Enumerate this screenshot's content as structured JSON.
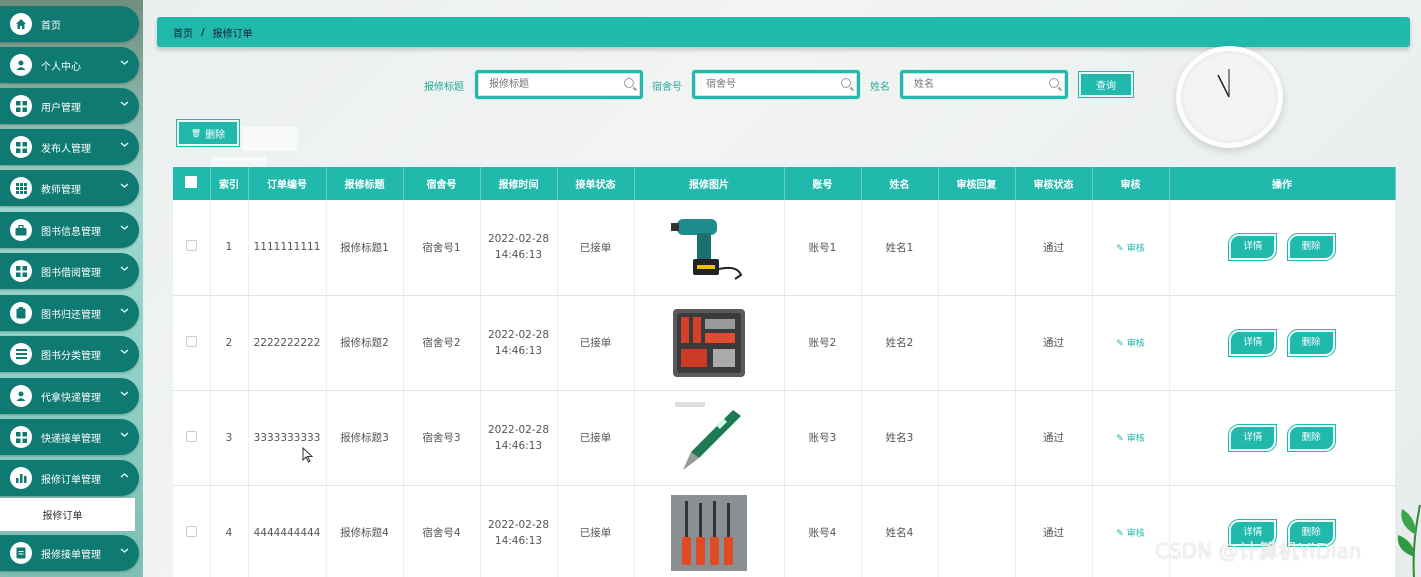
{
  "sidebar": {
    "items": [
      {
        "label": "首页",
        "icon": "home-icon",
        "has_chevron": false
      },
      {
        "label": "个人中心",
        "icon": "user-icon",
        "has_chevron": true
      },
      {
        "label": "用户管理",
        "icon": "grid-icon",
        "has_chevron": true
      },
      {
        "label": "发布人管理",
        "icon": "grid-icon",
        "has_chevron": true
      },
      {
        "label": "教师管理",
        "icon": "apps-icon",
        "has_chevron": true
      },
      {
        "label": "图书信息管理",
        "icon": "briefcase-icon",
        "has_chevron": true
      },
      {
        "label": "图书借阅管理",
        "icon": "grid-icon",
        "has_chevron": true
      },
      {
        "label": "图书归还管理",
        "icon": "clipboard-icon",
        "has_chevron": true
      },
      {
        "label": "图书分类管理",
        "icon": "list-icon",
        "has_chevron": true
      },
      {
        "label": "代拿快递管理",
        "icon": "user-icon",
        "has_chevron": true
      },
      {
        "label": "快递接单管理",
        "icon": "grid-icon",
        "has_chevron": true
      },
      {
        "label": "报修订单管理",
        "icon": "bar-chart-icon",
        "has_chevron": true
      },
      {
        "label": "报修接单管理",
        "icon": "document-icon",
        "has_chevron": true
      }
    ],
    "active_sub": "报修订单"
  },
  "breadcrumb": {
    "home": "首页",
    "sep": "/",
    "current": "报修订单"
  },
  "search": {
    "title_label": "报修标题",
    "title_placeholder": "报修标题",
    "dorm_label": "宿舍号",
    "dorm_placeholder": "宿舍号",
    "name_label": "姓名",
    "name_placeholder": "姓名",
    "query_button": "查询"
  },
  "toolbar": {
    "delete_button": "删除",
    "delete_icon": "trash-icon"
  },
  "table": {
    "headers": [
      "",
      "索引",
      "订单编号",
      "报修标题",
      "宿舍号",
      "报修时间",
      "接单状态",
      "报修图片",
      "账号",
      "姓名",
      "审核回复",
      "审核状态",
      "审核",
      "操作"
    ],
    "rows": [
      {
        "index": "1",
        "order_no": "1111111111",
        "title": "报修标题1",
        "dorm": "宿舍号1",
        "date": "2022-02-28",
        "time": "14:46:13",
        "status": "已接单",
        "image": "cordless-drill",
        "account": "账号1",
        "name": "姓名1",
        "reply": "",
        "audit_status": "通过",
        "audit_link": "审核",
        "detail_btn": "详情",
        "delete_btn": "删除"
      },
      {
        "index": "2",
        "order_no": "2222222222",
        "title": "报修标题2",
        "dorm": "宿舍号2",
        "date": "2022-02-28",
        "time": "14:46:13",
        "status": "已接单",
        "image": "tool-kit-case",
        "account": "账号2",
        "name": "姓名2",
        "reply": "",
        "audit_status": "通过",
        "audit_link": "审核",
        "detail_btn": "详情",
        "delete_btn": "删除"
      },
      {
        "index": "3",
        "order_no": "3333333333",
        "title": "报修标题3",
        "dorm": "宿舍号3",
        "date": "2022-02-28",
        "time": "14:46:13",
        "status": "已接单",
        "image": "voltage-tester-pen",
        "account": "账号3",
        "name": "姓名3",
        "reply": "",
        "audit_status": "通过",
        "audit_link": "审核",
        "detail_btn": "详情",
        "delete_btn": "删除"
      },
      {
        "index": "4",
        "order_no": "4444444444",
        "title": "报修标题4",
        "dorm": "宿舍号4",
        "date": "2022-02-28",
        "time": "14:46:13",
        "status": "已接单",
        "image": "screwdriver-set",
        "account": "账号4",
        "name": "姓名4",
        "reply": "",
        "audit_status": "通过",
        "audit_link": "审核",
        "detail_btn": "详情",
        "delete_btn": "删除"
      }
    ]
  },
  "watermark": "CSDN @计算机YiDian",
  "colors": {
    "accent": "#22b9ad",
    "sidebar_item": "#0e7a72"
  }
}
